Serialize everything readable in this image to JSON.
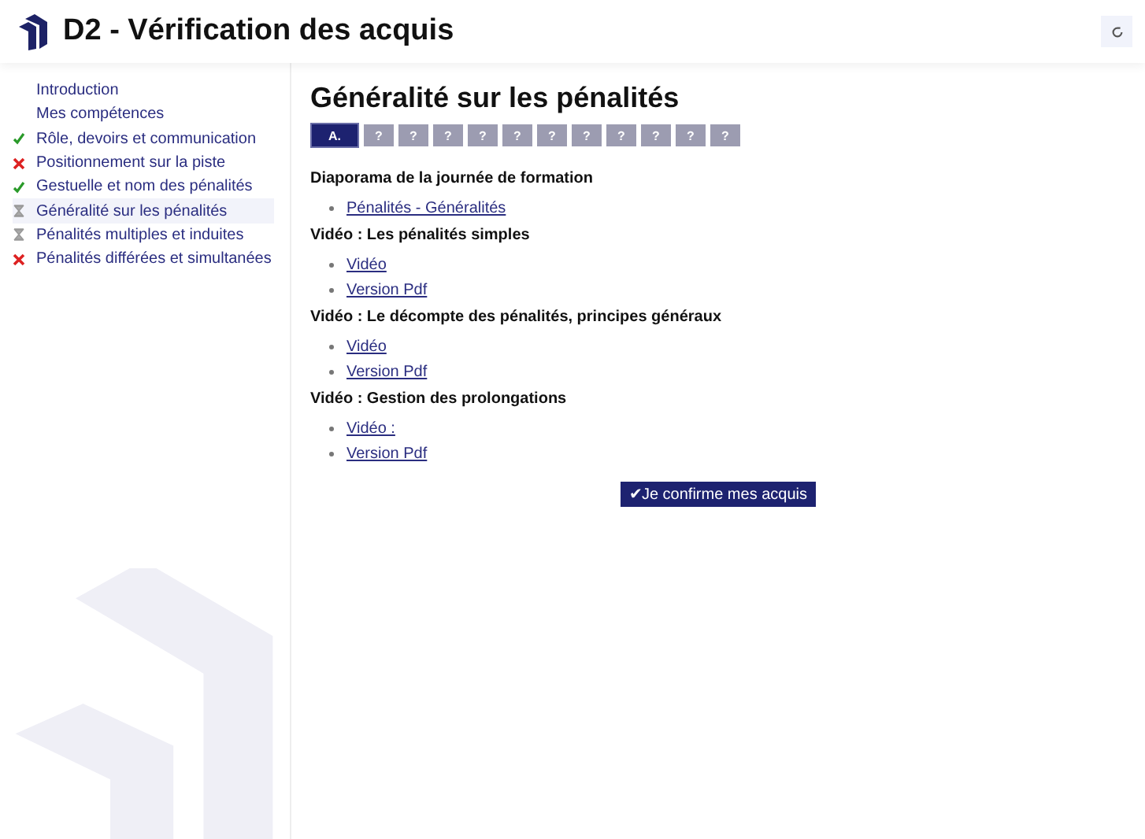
{
  "header": {
    "title": "D2 - Vérification des acquis"
  },
  "sidebar": {
    "items": [
      {
        "label": "Introduction",
        "kind": "plain",
        "selected": false
      },
      {
        "label": "Mes compétences",
        "kind": "plain",
        "selected": false
      },
      {
        "label": "Rôle, devoirs et communication",
        "kind": "done",
        "selected": false
      },
      {
        "label": "Positionnement sur la piste",
        "kind": "failed",
        "selected": false
      },
      {
        "label": "Gestuelle et nom des pénalités",
        "kind": "done",
        "selected": false
      },
      {
        "label": "Généralité sur les pénalités",
        "kind": "pending",
        "selected": true
      },
      {
        "label": "Pénalités multiples et induites",
        "kind": "pending",
        "selected": false
      },
      {
        "label": "Pénalités différées et simultanées",
        "kind": "failed",
        "selected": false
      }
    ]
  },
  "page": {
    "title": "Généralité sur les pénalités",
    "steps": [
      {
        "label": "A.",
        "selected": true
      },
      {
        "label": "?",
        "selected": false
      },
      {
        "label": "?",
        "selected": false
      },
      {
        "label": "?",
        "selected": false
      },
      {
        "label": "?",
        "selected": false
      },
      {
        "label": "?",
        "selected": false
      },
      {
        "label": "?",
        "selected": false
      },
      {
        "label": "?",
        "selected": false
      },
      {
        "label": "?",
        "selected": false
      },
      {
        "label": "?",
        "selected": false
      },
      {
        "label": "?",
        "selected": false
      },
      {
        "label": "?",
        "selected": false
      }
    ],
    "sections": [
      {
        "heading": "Diaporama de la journée de formation",
        "links": [
          "Pénalités - Généralités"
        ]
      },
      {
        "heading": "Vidéo : Les pénalités simples",
        "links": [
          "Vidéo",
          "Version Pdf"
        ]
      },
      {
        "heading": "Vidéo : Le décompte des pénalités, principes généraux",
        "links": [
          "Vidéo",
          "Version Pdf"
        ]
      },
      {
        "heading": "Vidéo : Gestion des prolongations",
        "links": [
          "Vidéo :",
          "Version Pdf"
        ]
      }
    ],
    "confirm_button": "✔Je confirme mes acquis"
  }
}
